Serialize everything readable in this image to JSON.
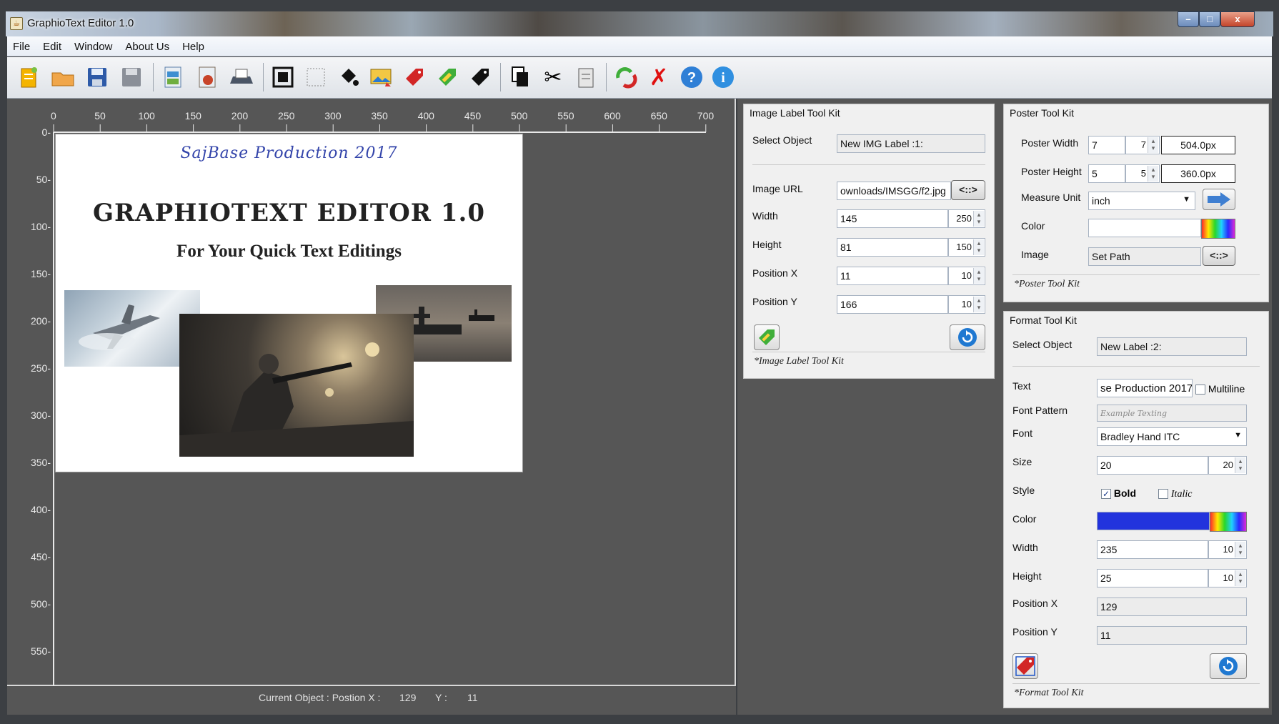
{
  "window": {
    "title": "GraphioText Editor 1.0",
    "btn_min": "–",
    "btn_max": "□",
    "btn_close": "x"
  },
  "menu": {
    "items": [
      "File",
      "Edit",
      "Window",
      "About Us",
      "Help"
    ]
  },
  "toolbar": {
    "icons": [
      "new-file-icon",
      "open-folder-icon",
      "save-icon",
      "save-as-icon",
      "export-jpg-icon",
      "export-png-icon",
      "print-icon",
      "fit-select-icon",
      "select-all-icon",
      "fill-bucket-icon",
      "insert-image-icon",
      "add-label-red-icon",
      "add-label-green-icon",
      "remove-label-icon",
      "copy-icon",
      "cut-icon",
      "paste-icon",
      "refresh-icon",
      "delete-icon",
      "help-icon",
      "info-icon"
    ]
  },
  "ruler": {
    "x_ticks": [
      "0",
      "50",
      "100",
      "150",
      "200",
      "250",
      "300",
      "350",
      "400",
      "450",
      "500",
      "550",
      "600",
      "650",
      "700"
    ],
    "y_ticks": [
      "0",
      "50",
      "100",
      "150",
      "200",
      "250",
      "300",
      "350",
      "400",
      "450",
      "500",
      "550"
    ]
  },
  "poster": {
    "subtitle_script": "SajBase Production 2017",
    "title": "GRAPHIOTEXT EDITOR 1.0",
    "tagline": "For Your Quick Text Editings"
  },
  "status": {
    "label_x": "Current Object : Postion X :",
    "x": "129",
    "label_y": "Y :",
    "y": "11"
  },
  "image_kit": {
    "header": "Image Label Tool Kit",
    "select_label": "Select Object",
    "select_value": "New IMG Label :1:",
    "url_label": "Image URL",
    "url_value": "ownloads/IMSGG/f2.jpg",
    "browse_btn": "<::>",
    "width_label": "Width",
    "width_value": "145",
    "width_step": "250",
    "height_label": "Height",
    "height_value": "81",
    "height_step": "150",
    "posx_label": "Position X",
    "posx_value": "11",
    "posx_step": "10",
    "posy_label": "Position Y",
    "posy_value": "166",
    "posy_step": "10",
    "footer": "*Image Label Tool Kit"
  },
  "poster_kit": {
    "header": "Poster Tool Kit",
    "pw_label": "Poster Width",
    "pw_value": "7",
    "pw_step": "7",
    "pw_px": "504.0px",
    "ph_label": "Poster Height",
    "ph_value": "5",
    "ph_step": "5",
    "ph_px": "360.0px",
    "unit_label": "Measure Unit",
    "unit_value": "inch",
    "color_label": "Color",
    "image_label": "Image",
    "image_value": "Set Path",
    "browse_btn": "<::>",
    "footer": "*Poster Tool Kit"
  },
  "format_kit": {
    "header": "Format Tool Kit",
    "select_label": "Select Object",
    "select_value": "New Label :2:",
    "text_label": "Text",
    "text_value": "se Production 2017",
    "multiline_label": "Multiline",
    "pattern_label": "Font Pattern",
    "pattern_value": "Example Texting",
    "font_label": "Font",
    "font_value": "Bradley Hand ITC",
    "size_label": "Size",
    "size_value": "20",
    "size_step": "20",
    "style_label": "Style",
    "bold_label": "Bold",
    "italic_label": "Italic",
    "color_label": "Color",
    "width_label": "Width",
    "width_value": "235",
    "width_step": "10",
    "height_label": "Height",
    "height_value": "25",
    "height_step": "10",
    "posx_label": "Position X",
    "posx_value": "129",
    "posy_label": "Position Y",
    "posy_value": "11",
    "footer": "*Format Tool Kit"
  },
  "colors": {
    "text_color": "#2233dd",
    "accent": "#1f6fd6",
    "poster_bg": "#ffffff",
    "canvas_bg": "#565656"
  }
}
